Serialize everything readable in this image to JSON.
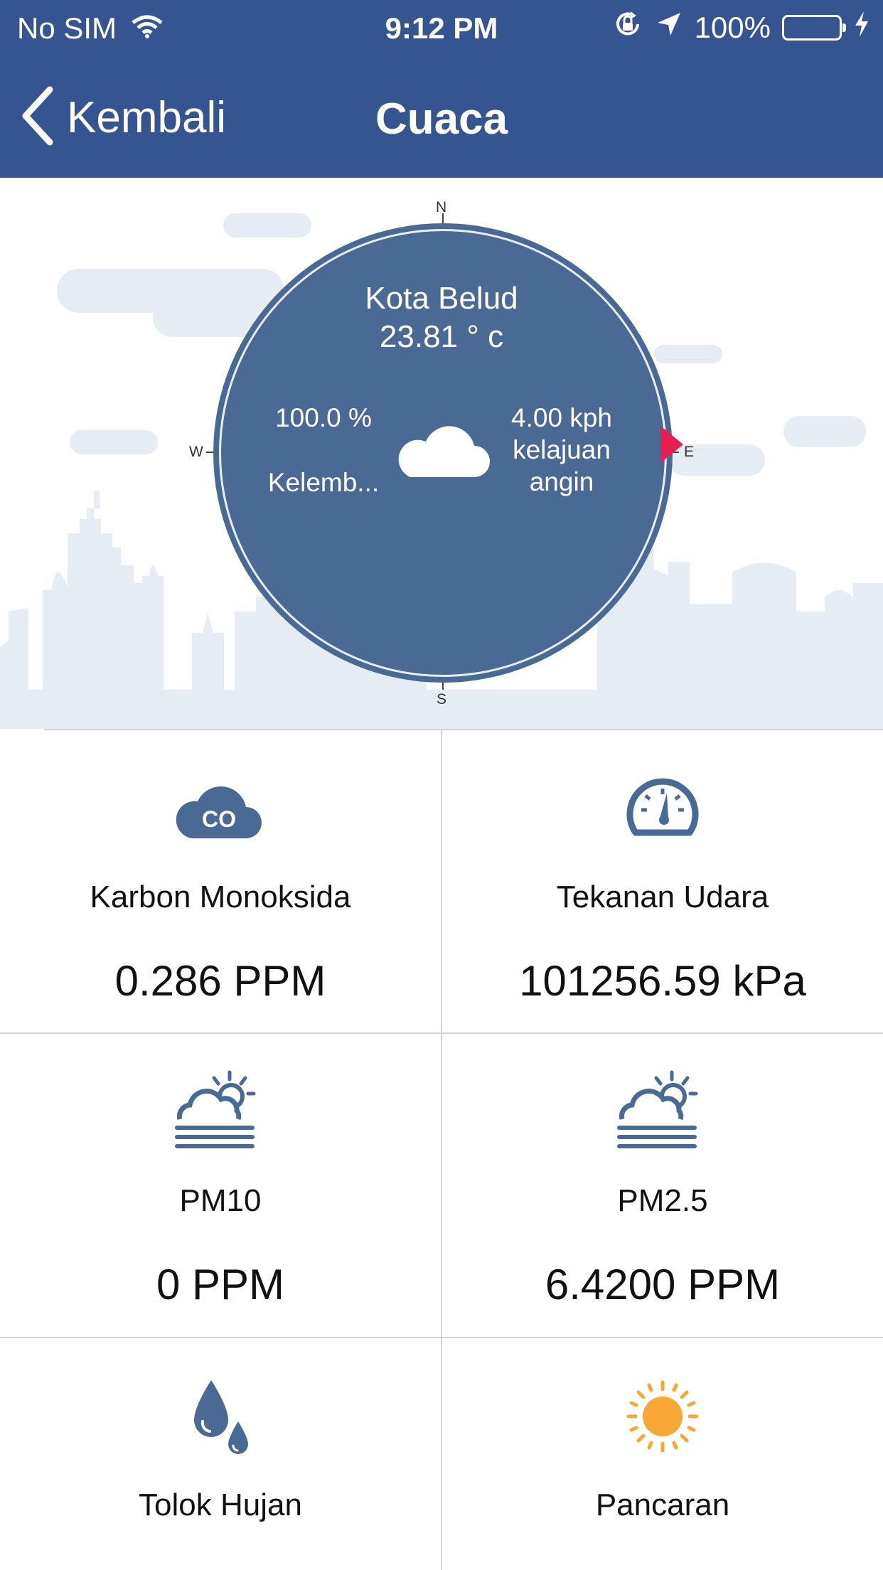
{
  "status_bar": {
    "carrier": "No SIM",
    "time": "9:12 PM",
    "battery": "100%"
  },
  "nav": {
    "back_label": "Kembali",
    "title": "Cuaca"
  },
  "compass": {
    "city": "Kota Belud",
    "temperature": "23.81 ° c",
    "humidity_value": "100.0 %",
    "humidity_label": "Kelemb...",
    "wind_value": "4.00 kph",
    "wind_label_line1": "kelajuan",
    "wind_label_line2": "angin",
    "north": "N",
    "south": "S",
    "west": "W",
    "east": "E",
    "needle_color": "#e8204f"
  },
  "metrics": [
    {
      "label": "Karbon Monoksida",
      "value": "0.286 PPM",
      "icon": "co-cloud-icon",
      "icon_text": "CO"
    },
    {
      "label": "Tekanan Udara",
      "value": "101256.59 kPa",
      "icon": "gauge-icon"
    },
    {
      "label": "PM10",
      "value": "0 PPM",
      "icon": "haze-icon"
    },
    {
      "label": "PM2.5",
      "value": "6.4200 PPM",
      "icon": "haze-icon"
    },
    {
      "label": "Tolok Hujan",
      "value": "",
      "icon": "raindrops-icon"
    },
    {
      "label": "Pancaran",
      "value": "",
      "icon": "sun-icon"
    }
  ],
  "colors": {
    "header": "#34558f",
    "dial": "#4a6a96",
    "icon": "#4a6a96",
    "sun": "#f7a733"
  }
}
